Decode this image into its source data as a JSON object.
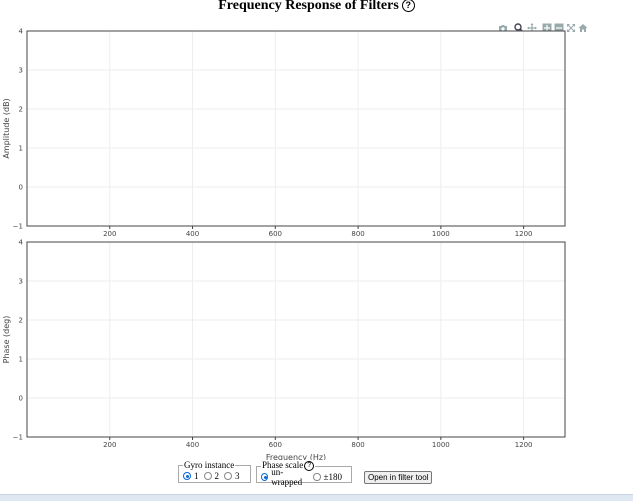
{
  "title": "Frequency Response of Filters",
  "help_glyph": "?",
  "modebar": {
    "icons": [
      "camera-icon",
      "zoom-icon",
      "pan-icon",
      "zoom-in-icon",
      "zoom-out-icon",
      "autoscale-icon",
      "home-icon"
    ]
  },
  "chart_data": [
    {
      "type": "line",
      "title": "",
      "xlabel": "",
      "ylabel": "Amplitude (dB)",
      "xlim": [
        0,
        1300
      ],
      "ylim": [
        -1,
        4
      ],
      "x_ticks": [
        200,
        400,
        600,
        800,
        1000,
        1200
      ],
      "x_tick_labels": [
        "200",
        "400",
        "600",
        "800",
        "1000",
        "1200"
      ],
      "y_ticks": [
        -1,
        0,
        1,
        2,
        3,
        4
      ],
      "y_tick_labels": [
        "−1",
        "0",
        "1",
        "2",
        "3",
        "4"
      ],
      "grid": true,
      "series": []
    },
    {
      "type": "line",
      "title": "",
      "xlabel": "Frequency (Hz)",
      "ylabel": "Phase (deg)",
      "xlim": [
        0,
        1300
      ],
      "ylim": [
        -1,
        4
      ],
      "x_ticks": [
        200,
        400,
        600,
        800,
        1000,
        1200
      ],
      "x_tick_labels": [
        "200",
        "400",
        "600",
        "800",
        "1000",
        "1200"
      ],
      "y_ticks": [
        -1,
        0,
        1,
        2,
        3,
        4
      ],
      "y_tick_labels": [
        "−1",
        "0",
        "1",
        "2",
        "3",
        "4"
      ],
      "grid": true,
      "series": []
    }
  ],
  "controls": {
    "gyro": {
      "legend": "Gyro instance",
      "options": [
        "1",
        "2",
        "3"
      ],
      "selected": "1"
    },
    "phase": {
      "legend": "Phase scale",
      "options": [
        "un-wrapped",
        "±180"
      ],
      "selected": "un-wrapped"
    },
    "filter_button": "Open in filter tool"
  },
  "colors": {
    "accent": "#0a67d8",
    "grid": "#eeeeee",
    "axis": "#444444"
  }
}
